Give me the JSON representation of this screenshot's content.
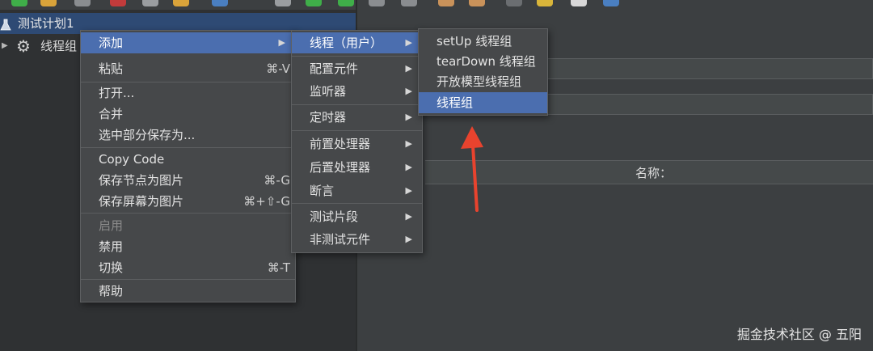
{
  "tree": {
    "plan_label": "测试计划1",
    "thread_group_label": "线程组",
    "plan_icon": "flask-icon",
    "gear_icon": "gear-icon",
    "expand_icon": "triangle-right-icon"
  },
  "context_menu": {
    "items": [
      {
        "label": "添加",
        "submenu": true,
        "selected": true
      },
      {
        "label": "粘贴",
        "shortcut": "⌘-V"
      },
      {
        "label": "打开..."
      },
      {
        "label": "合并"
      },
      {
        "label": "选中部分保存为..."
      },
      {
        "label": "Copy Code"
      },
      {
        "label": "保存节点为图片",
        "shortcut": "⌘-G"
      },
      {
        "label": "保存屏幕为图片",
        "shortcut": "⌘+⇧-G"
      },
      {
        "label": "启用",
        "disabled": true
      },
      {
        "label": "禁用"
      },
      {
        "label": "切换",
        "shortcut": "⌘-T"
      },
      {
        "label": "帮助"
      }
    ]
  },
  "add_submenu": {
    "items": [
      {
        "label": "线程（用户）",
        "selected": true
      },
      {
        "label": "配置元件"
      },
      {
        "label": "监听器"
      },
      {
        "label": "定时器"
      },
      {
        "label": "前置处理器"
      },
      {
        "label": "后置处理器"
      },
      {
        "label": "断言"
      },
      {
        "label": "测试片段"
      },
      {
        "label": "非测试元件"
      }
    ]
  },
  "thread_submenu": {
    "items": [
      {
        "label": "setUp 线程组"
      },
      {
        "label": "tearDown 线程组"
      },
      {
        "label": "开放模型线程组"
      },
      {
        "label": "线程组",
        "selected": true
      }
    ]
  },
  "right_pane": {
    "table_name_header": "名称："
  },
  "annotation": {
    "arrow_color": "#e8432e"
  },
  "watermark": "掘金技术社区 @ 五阳"
}
